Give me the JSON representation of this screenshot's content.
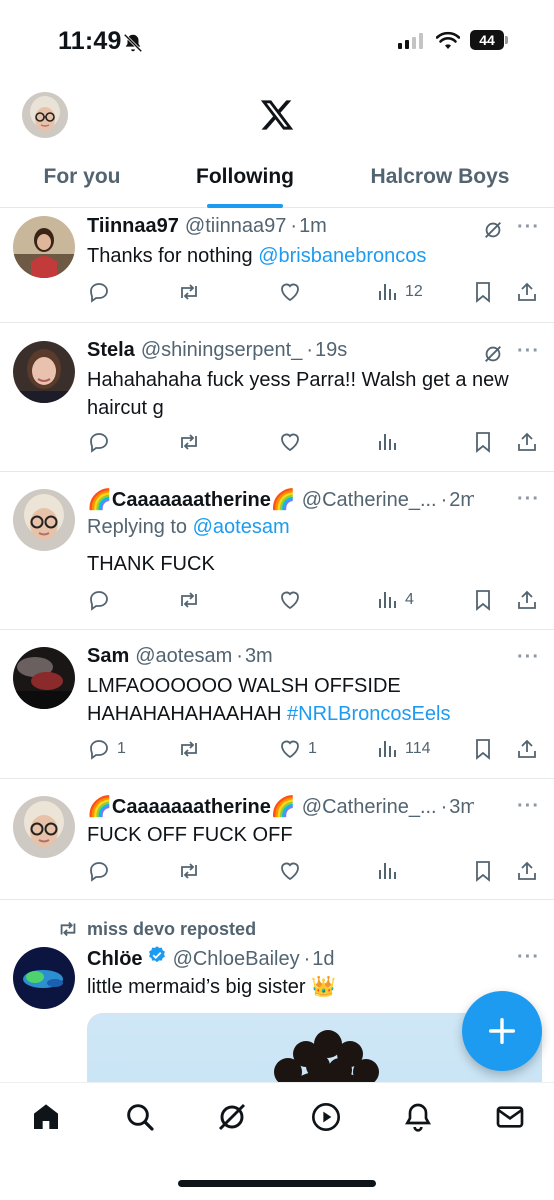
{
  "status_bar": {
    "time": "11:49",
    "battery": "44",
    "icons": [
      "bell-slash-icon",
      "signal-icon",
      "wifi-icon",
      "battery-icon"
    ]
  },
  "header": {
    "logo": "x-logo-icon",
    "tabs": [
      {
        "label": "For you",
        "active": false
      },
      {
        "label": "Following",
        "active": true
      },
      {
        "label": "Halcrow Boys",
        "active": false
      }
    ]
  },
  "tweets": [
    {
      "name": "Tiinnaa97",
      "handle": "@tiinnaa97",
      "time": "1m",
      "text": "Thanks for nothing ",
      "link": "@brisbanebroncos",
      "replies": "",
      "likes": "",
      "views": "12"
    },
    {
      "name": "Stela",
      "handle": "@shiningserpent_",
      "time": "19s",
      "text_line1": "Hahahahaha fuck yess Parra!! Walsh get a new",
      "text_line2": "haircut g",
      "views": ""
    },
    {
      "name": "🌈Caaaaaaatherine🌈",
      "handle": "@Catherine_...",
      "time": "2m",
      "replying_prefix": "Replying to ",
      "replying_to": "@aotesam",
      "text": "THANK FUCK",
      "views": "4"
    },
    {
      "name": "Sam",
      "handle": "@aotesam",
      "time": "3m",
      "text_line1": "LMFAOOOOOO WALSH OFFSIDE",
      "text_line2": "HAHAHAHAHAAHAH ",
      "hashtag": "#NRLBroncosEels",
      "replies": "1",
      "likes": "1",
      "views": "114"
    },
    {
      "name": "🌈Caaaaaaatherine🌈",
      "handle": "@Catherine_...",
      "time": "3m",
      "text": "FUCK OFF FUCK OFF",
      "views": ""
    },
    {
      "repost_by": "miss devo reposted",
      "name": "Chlöe",
      "handle": "@ChloeBailey",
      "time": "1d",
      "text": "little mermaid’s big sister 👑"
    }
  ],
  "dot_sep": "·",
  "more": "···",
  "fab": {
    "icon": "plus-icon",
    "label": "+"
  },
  "bottom_nav": [
    "home-icon",
    "search-icon",
    "grok-icon",
    "video-icon",
    "notifications-icon",
    "messages-icon"
  ],
  "colors": {
    "accent": "#1d9bf0",
    "text": "#0f1419",
    "muted": "#536471"
  }
}
